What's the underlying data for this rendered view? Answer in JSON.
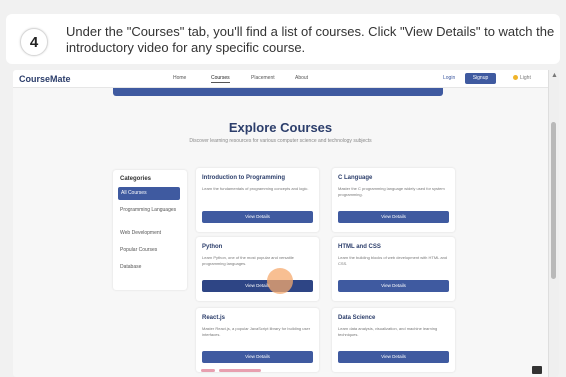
{
  "step": {
    "number": "4",
    "instruction": "Under the \"Courses\" tab, you'll find a list of courses. Click \"View Details\" to watch the introductory video for any specific course."
  },
  "app": {
    "brand": "CourseMate",
    "nav": [
      "Home",
      "Courses",
      "Placement",
      "About"
    ],
    "active_nav": "Courses",
    "login": "Login",
    "signup": "Signup",
    "theme": "Light"
  },
  "page": {
    "title": "Explore Courses",
    "subtitle": "Discover learning resources for various computer science and technology subjects"
  },
  "sidebar": {
    "title": "Categories",
    "items": [
      "All Courses",
      "Programming Languages",
      "Web Development",
      "Popular Courses",
      "Database"
    ],
    "active": "All Courses"
  },
  "courses": [
    {
      "title": "Introduction to Programming",
      "desc": "Learn the fundamentals of programming concepts and logic.",
      "button": "View Details"
    },
    {
      "title": "C Language",
      "desc": "Master the C programming language widely used for system programming.",
      "button": "View Details"
    },
    {
      "title": "Python",
      "desc": "Learn Python, one of the most popular and versatile programming languages.",
      "button": "View Details"
    },
    {
      "title": "HTML and CSS",
      "desc": "Learn the building blocks of web development with HTML and CSS.",
      "button": "View Details"
    },
    {
      "title": "React.js",
      "desc": "Master React.js, a popular JavaScript library for building user interfaces.",
      "button": "View Details"
    },
    {
      "title": "Data Science",
      "desc": "Learn data analysis, visualization, and machine learning techniques.",
      "button": "View Details"
    }
  ],
  "colors": {
    "accent": "#3f5aa0",
    "brand": "#2c3e6b",
    "cursor_highlight": "#f5aa6e"
  }
}
